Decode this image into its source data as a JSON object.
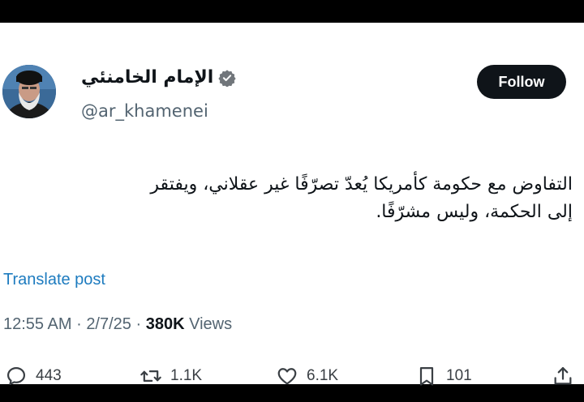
{
  "author": {
    "display_name": "الإمام الخامنئي",
    "handle": "@ar_khamenei",
    "verified_icon": "verified-badge-icon",
    "badge_color": "#71767b"
  },
  "follow_button": {
    "label": "Follow"
  },
  "tweet": {
    "lines": [
      "التفاوض مع حكومة كأمريكا يُعدّ تصرّفًا غير عقلاني، ويفتقر",
      "إلى الحكمة، وليس مشرّفًا."
    ]
  },
  "translate_link": {
    "label": "Translate post"
  },
  "meta": {
    "time": "12:55 AM",
    "date": "2/7/25",
    "separator": "·",
    "views_count": "380K",
    "views_label": "Views"
  },
  "actions": {
    "reply": {
      "icon": "reply-icon",
      "count": "443"
    },
    "repost": {
      "icon": "repost-icon",
      "count": "1.1K"
    },
    "like": {
      "icon": "heart-icon",
      "count": "6.1K"
    },
    "bookmark": {
      "icon": "bookmark-icon",
      "count": "101"
    },
    "share": {
      "icon": "share-icon"
    }
  },
  "colors": {
    "text": "#0f1419",
    "secondary": "#536471",
    "link": "#1d7bbf",
    "follow_bg": "#0f1419"
  }
}
